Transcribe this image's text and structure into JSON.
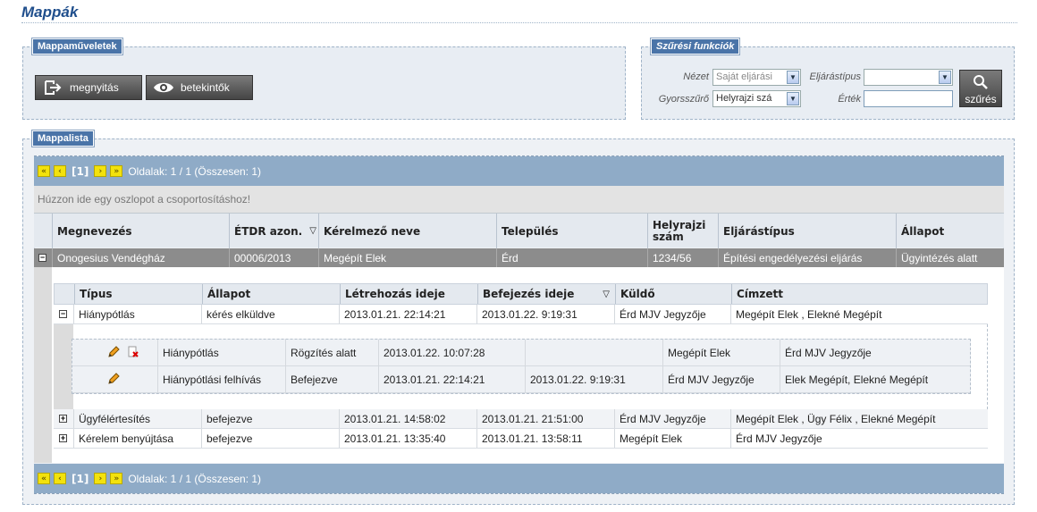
{
  "page": {
    "title": "Mappák"
  },
  "ops": {
    "legend": "Mappaműveletek",
    "open_label": "megnyitás",
    "viewers_label": "betekintők"
  },
  "filter": {
    "legend": "Szűrési funkciók",
    "view_label": "Nézet",
    "view_value": "Saját eljárási",
    "proc_type_label": "Eljárástípus",
    "proc_type_value": "",
    "quick_label": "Gyorsszűrő",
    "quick_value": "Helyrajzi szá",
    "value_label": "Érték",
    "value_value": "",
    "filter_button": "szűrés"
  },
  "list": {
    "legend": "Mappalista",
    "pager": {
      "current": "[1]",
      "info": "Oldalak: 1 / 1 (Összesen: 1)"
    },
    "group_hint": "Húzzon ide egy oszlopot a csoportosításhoz!",
    "columns": [
      "Megnevezés",
      "ÉTDR azon.",
      "Kérelmező neve",
      "Település",
      "Helyrajzi szám",
      "Eljárástípus",
      "Állapot"
    ],
    "row": [
      "Onogesius Vendégház",
      "00006/2013",
      "Megépít Elek",
      "Érd",
      "1234/56",
      "Építési engedélyezési eljárás",
      "Ügyintézés alatt"
    ]
  },
  "sub": {
    "columns": [
      "Típus",
      "Állapot",
      "Létrehozás ideje",
      "Befejezés ideje",
      "Küldő",
      "Címzett"
    ],
    "rows": [
      [
        "Hiánypótlás",
        "kérés elküldve",
        "2013.01.21. 22:14:21",
        "2013.01.22. 9:19:31",
        "Érd MJV Jegyzője",
        "Megépít Elek , Elekné Megépít"
      ],
      [
        "Ügyfélértesítés",
        "befejezve",
        "2013.01.21. 14:58:02",
        "2013.01.21. 21:51:00",
        "Érd MJV Jegyzője",
        "Megépít Elek , Ügy Félix , Elekné Megépít"
      ],
      [
        "Kérelem benyújtása",
        "befejezve",
        "2013.01.21. 13:35:40",
        "2013.01.21. 13:58:11",
        "Megépít Elek",
        "Érd MJV Jegyzője"
      ]
    ],
    "nested": [
      [
        "Hiánypótlás",
        "Rögzítés alatt",
        "2013.01.22. 10:07:28",
        "",
        "Megépít Elek",
        "Érd MJV Jegyzője"
      ],
      [
        "Hiánypótlási felhívás",
        "Befejezve",
        "2013.01.21. 22:14:21",
        "2013.01.22. 9:19:31",
        "Érd MJV Jegyzője",
        "Elek Megépít, Elekné Megépít"
      ]
    ]
  }
}
